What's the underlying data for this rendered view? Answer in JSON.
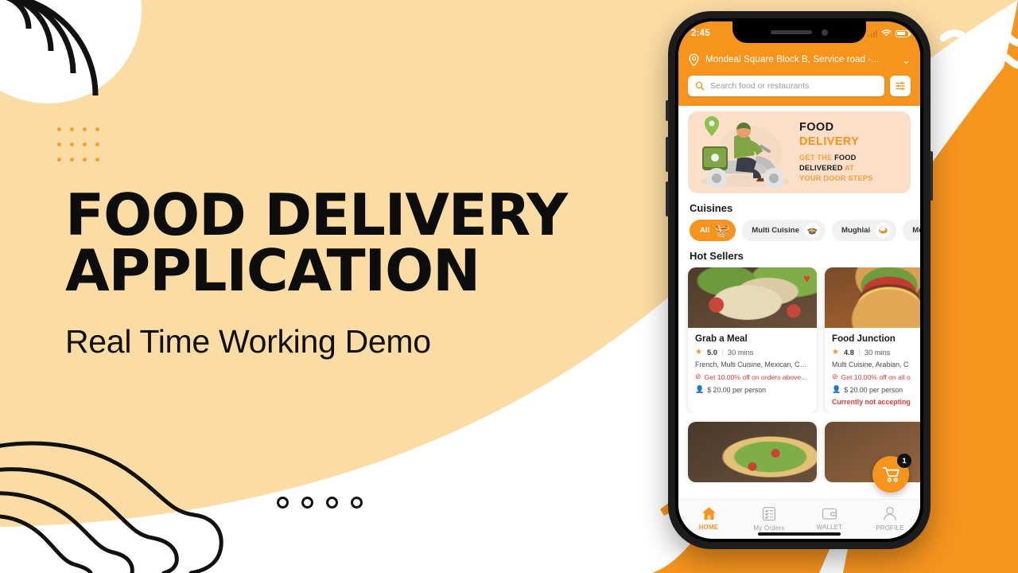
{
  "slide": {
    "headline_line1": "FOOD DELIVERY",
    "headline_line2": "APPLICATION",
    "subheadline": "Real Time Working Demo",
    "pagination_dots": 4,
    "colors": {
      "peach": "#FBDCA4",
      "orange": "#F7941E",
      "white": "#FFFFFF",
      "ink": "#111111"
    }
  },
  "phone": {
    "status_bar": {
      "time": "2:45",
      "signal_icon": "signal-bars-icon",
      "wifi_icon": "wifi-icon",
      "battery_icon": "battery-icon"
    },
    "header": {
      "location_icon": "location-pin-icon",
      "location_text": "Mondeal Square Block B, Service road -...",
      "chevron_icon": "chevron-down-icon",
      "search": {
        "icon": "search-icon",
        "placeholder": "Search food or restaurants",
        "value": ""
      },
      "filter_icon": "filter-sliders-icon"
    },
    "promo": {
      "title_line1": "FOOD",
      "title_line2": "DELIVERY",
      "sub_a": "GET THE",
      "sub_b": "FOOD",
      "sub_c": "DELIVERED",
      "sub_d": "AT",
      "sub_e": "YOUR DOOR STEPS",
      "art_icon": "delivery-scooter-illustration"
    },
    "sections": {
      "cuisines_title": "Cuisines",
      "hot_sellers_title": "Hot Sellers"
    },
    "cuisines": [
      {
        "label": "All",
        "icon": "basket-icon",
        "active": true
      },
      {
        "label": "Multi Cuisine",
        "icon": "multi-cuisine-icon",
        "active": false
      },
      {
        "label": "Mughlai",
        "icon": "mughlai-icon",
        "active": false
      },
      {
        "label": "Mexican",
        "icon": "mexican-icon",
        "active": false
      }
    ],
    "restaurants": [
      {
        "name": "Grab a Meal",
        "rating": "5.0",
        "time": "30 mins",
        "tags": "French, Multi Cuisine, Mexican, Chi...",
        "offer": "Get 10.00% off on orders above...",
        "price": "$ 20.00 per person",
        "status": "",
        "favorite": true,
        "thumb": "wraps-photo"
      },
      {
        "name": "Food Junction",
        "rating": "4.8",
        "time": "30 mins",
        "tags": "Multi Cuisine, Arabian, C",
        "offer": "Get 10.00% off on all o",
        "price": "$ 20.00 per person",
        "status": "Currently not accepting",
        "favorite": false,
        "thumb": "burger-photo"
      }
    ],
    "restaurants_row2": [
      {
        "thumb": "pizza-photo"
      },
      {
        "thumb": "food-photo"
      }
    ],
    "cart": {
      "icon": "shopping-cart-icon",
      "badge": "1"
    },
    "tabs": [
      {
        "label": "HOME",
        "icon": "home-icon",
        "active": true
      },
      {
        "label": "My Orders",
        "icon": "orders-list-icon",
        "active": false
      },
      {
        "label": "WALLET",
        "icon": "wallet-icon",
        "active": false
      },
      {
        "label": "PROFILE",
        "icon": "person-icon",
        "active": false
      }
    ]
  }
}
